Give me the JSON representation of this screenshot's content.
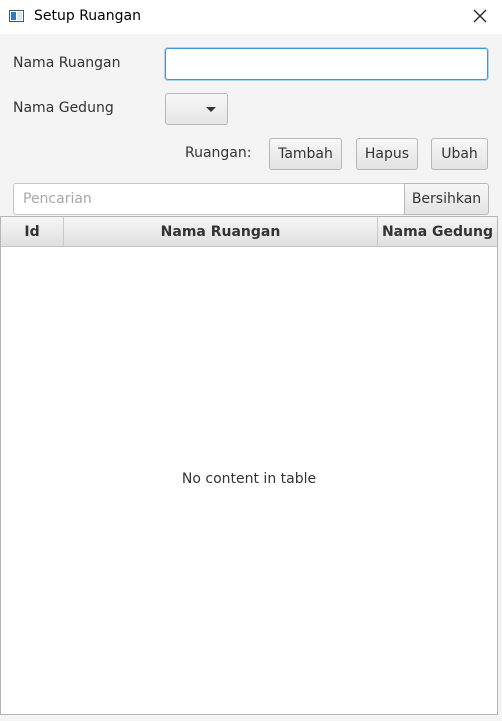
{
  "window": {
    "title": "Setup Ruangan",
    "icon": "app-window-icon",
    "close_icon": "close-icon"
  },
  "form": {
    "nama_ruangan_label": "Nama Ruangan",
    "nama_ruangan_value": "",
    "nama_gedung_label": "Nama Gedung",
    "nama_gedung_selected": "",
    "ruangan_label": "Ruangan:",
    "tambah_label": "Tambah",
    "hapus_label": "Hapus",
    "ubah_label": "Ubah"
  },
  "search": {
    "placeholder": "Pencarian",
    "value": "",
    "clear_label": "Bersihkan"
  },
  "table": {
    "columns": [
      "Id",
      "Nama Ruangan",
      "Nama Gedung"
    ],
    "rows": [],
    "empty_message": "No content in table"
  },
  "colors": {
    "focus_border": "#3a9ad9",
    "window_background": "#f4f4f4"
  }
}
